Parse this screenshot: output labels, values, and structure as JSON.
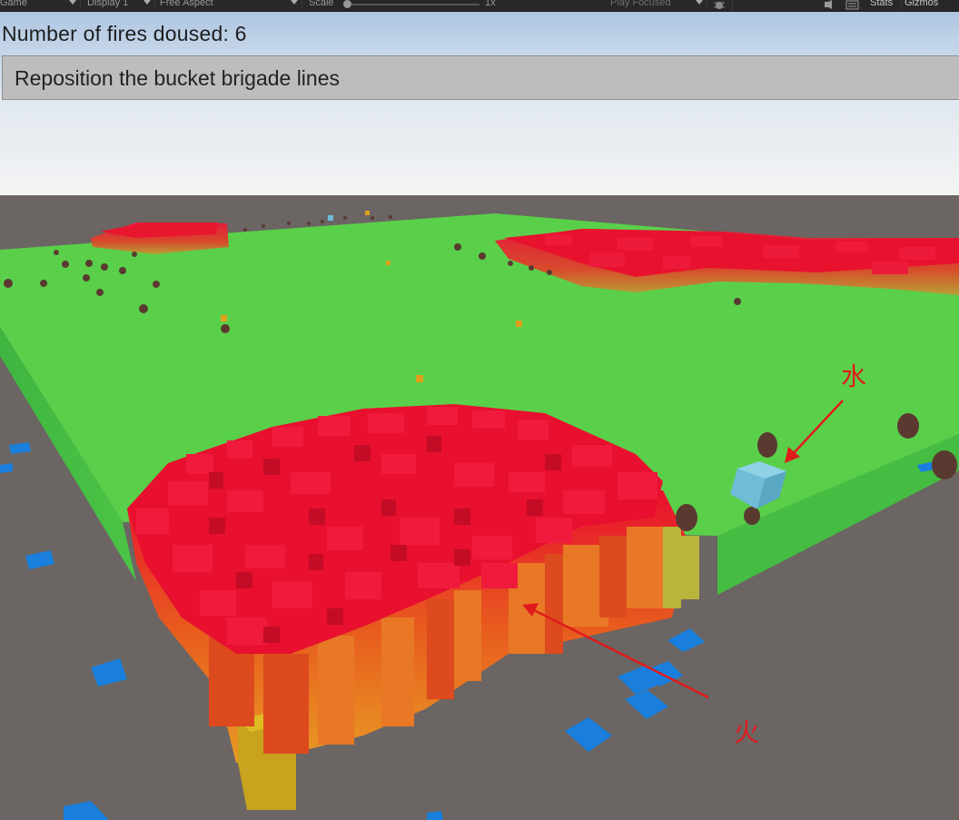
{
  "toolbar": {
    "game_tab": "Game",
    "display": "Display 1",
    "aspect": "Free Aspect",
    "scale_label": "Scale",
    "scale_value": "1x",
    "play_mode": "Play Focused",
    "stats": "Stats",
    "gizmos": "Gizmos",
    "icons": [
      "audio-icon",
      "keyboard-icon",
      "bug-icon"
    ]
  },
  "hud": {
    "score_text": "Number of fires doused: 6",
    "button_label": "Reposition the bucket brigade lines"
  },
  "annotations": {
    "water_label": "水",
    "fire_label": "火",
    "color": "#e11b1b"
  },
  "colors": {
    "grass": "#5ad04a",
    "fire_top": "#e8102e",
    "fire_mid": "#e85a1e",
    "fire_low": "#e89a24",
    "water_tile": "#1a7fdc",
    "bucket": "#6fbcd6",
    "ground": "#6b6563"
  }
}
